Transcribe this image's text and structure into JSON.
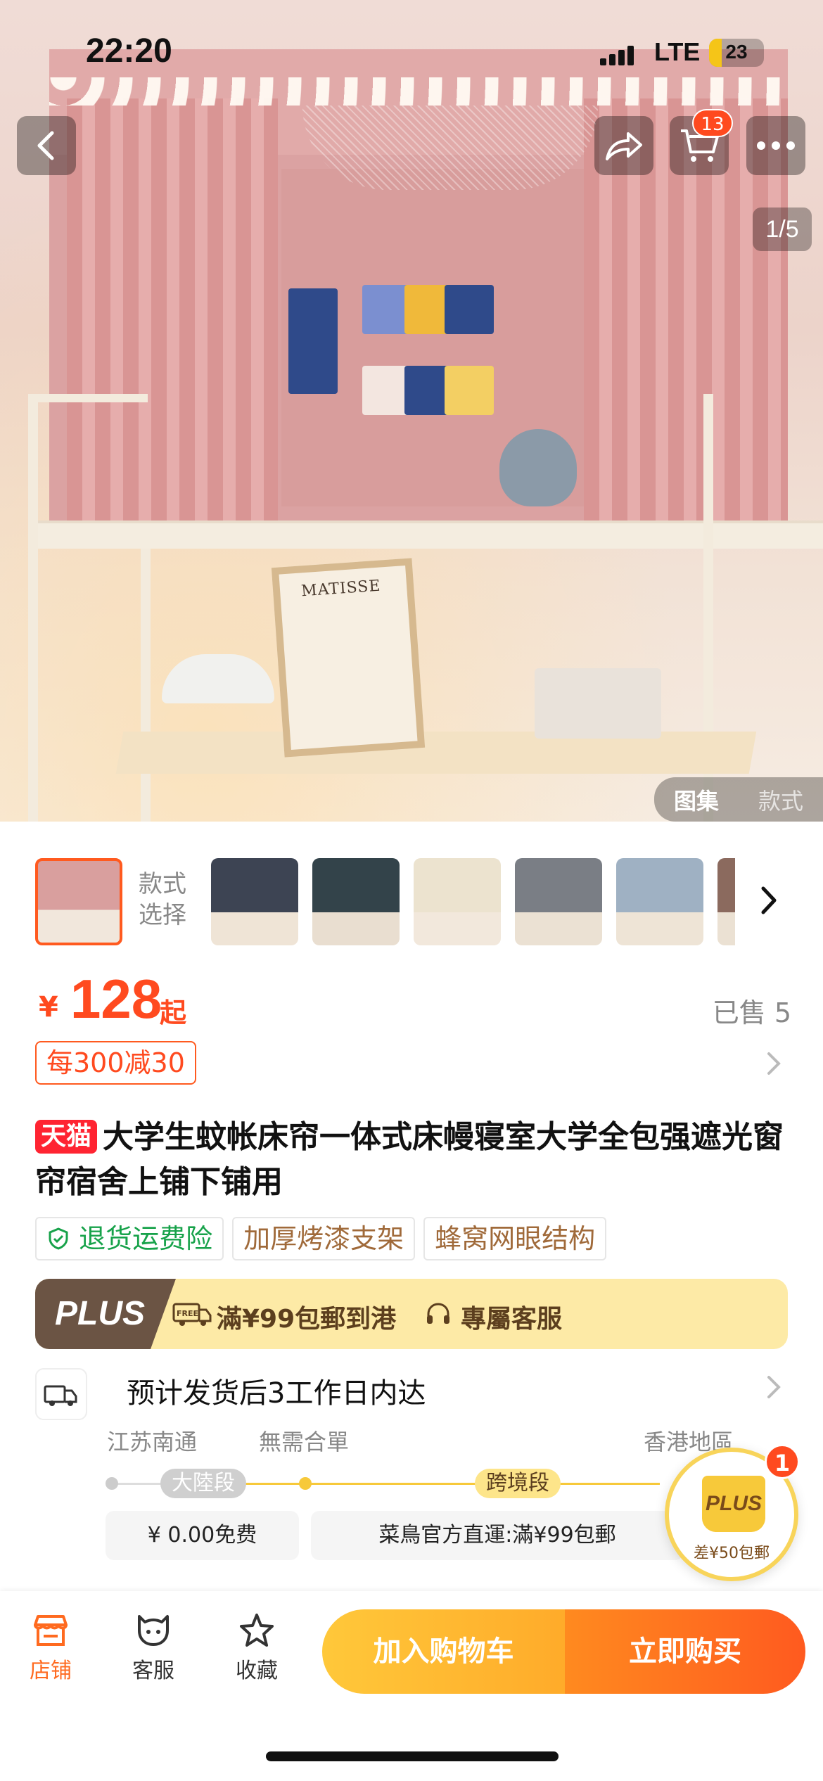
{
  "status_bar": {
    "time": "22:20",
    "network": "LTE",
    "battery": "23",
    "battery_level": 0.23
  },
  "hero": {
    "cart_count": "13",
    "image_counter": "1/5",
    "poster_text": "MATISSE",
    "view_tabs": [
      "图集",
      "款式"
    ]
  },
  "thumbnails": {
    "label": "款式\n选择",
    "count": 7
  },
  "price": {
    "currency": "¥",
    "amount": "128",
    "suffix": "起",
    "sold": "已售 5"
  },
  "promo": {
    "text": "每300减30"
  },
  "product": {
    "store_badge": "天猫",
    "title": "大学生蚊帐床帘一体式床幔寝室大学全包强遮光窗帘宿舍上铺下铺用",
    "tags": [
      "退货运费险",
      "加厚烤漆支架",
      "蜂窝网眼结构"
    ]
  },
  "plus_banner": {
    "logo": "PLUS",
    "free_icon": "FREE",
    "shipping": "滿¥99包郵到港",
    "service": "專屬客服"
  },
  "delivery": {
    "estimate": "预计发货后3工作日内达",
    "origin": "江苏南通",
    "no_consolidation": "無需合單",
    "destination": "香港地區",
    "segment_mainland": "大陸段",
    "segment_crossborder": "跨境段",
    "fee_mainland": "¥ 0.00免费",
    "fee_crossborder": "菜鳥官方直運:滿¥99包郵"
  },
  "float_plus": {
    "badge": "1",
    "logo": "PLUS",
    "text": "差¥50包郵"
  },
  "bottom_bar": {
    "tabs": [
      {
        "label": "店铺"
      },
      {
        "label": "客服"
      },
      {
        "label": "收藏"
      }
    ],
    "add_to_cart": "加入购物车",
    "buy_now": "立即购买"
  },
  "colors": {
    "accent": "#ff4a1f",
    "plus_gold": "#fdeaa6",
    "plus_brown": "#6b5444",
    "tmall_red": "#ff2432"
  }
}
